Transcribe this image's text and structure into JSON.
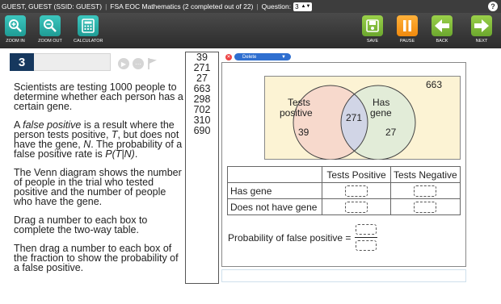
{
  "topbar": {
    "user": "GUEST, GUEST (SSID: GUEST)",
    "test": "FSA EOC Mathematics (2 completed out of 22)",
    "question_label": "Question:",
    "question_value": "3",
    "help": "?"
  },
  "toolbar": {
    "zoom_in": "ZOOM IN",
    "zoom_out": "ZOOM OUT",
    "calculator": "CALCULATOR",
    "save": "SAVE",
    "pause": "PAUSE",
    "back": "BACK",
    "next": "NEXT"
  },
  "question": {
    "number": "3",
    "p1": "Scientists are testing 1000 people to determine whether each person has a certain gene.",
    "p2_a": "A ",
    "p2_em": "false positive",
    "p2_b": " is a result where the person tests positive, ",
    "p2_t": "T",
    "p2_c": ", but does not have the gene, ",
    "p2_n": "N",
    "p2_d": ". The probability of a false positive rate is ",
    "p2_p": "P(T|N)",
    "p2_e": ".",
    "p3": "The Venn diagram shows the number of people in the trial who tested positive and the number of people who have the gene.",
    "p4": "Drag a number to each box to complete the two-way table.",
    "p5": "Then drag a number to each box of the fraction to show the probability of a false positive."
  },
  "bank": [
    "39",
    "271",
    "27",
    "663",
    "298",
    "702",
    "310",
    "690"
  ],
  "delete_label": "Delete",
  "venn": {
    "outside": "663",
    "left_label_1": "Tests",
    "left_label_2": "positive",
    "right_label_1": "Has",
    "right_label_2": "gene",
    "left_only": "39",
    "both": "271",
    "right_only": "27",
    "colors": {
      "background": "#fcf3d4",
      "left": "#f7d9cc",
      "right": "#e2ecd8",
      "overlap": "#d1d5e6"
    }
  },
  "table": {
    "col1": "Tests Positive",
    "col2": "Tests Negative",
    "row1": "Has gene",
    "row2": "Does not have gene"
  },
  "probability_label": "Probability of false positive ="
}
